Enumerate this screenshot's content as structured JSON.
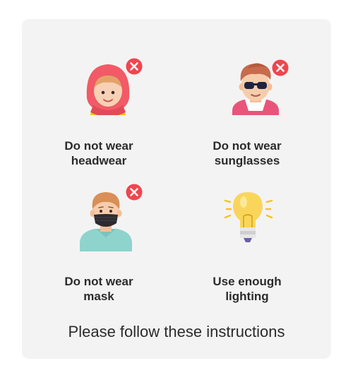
{
  "instructions": [
    {
      "id": "headwear",
      "line1": "Do not wear",
      "line2": "headwear",
      "status": "not-allowed",
      "icon": "person-headscarf-icon"
    },
    {
      "id": "sunglasses",
      "line1": "Do not wear",
      "line2": "sunglasses",
      "status": "not-allowed",
      "icon": "person-sunglasses-icon"
    },
    {
      "id": "mask",
      "line1": "Do not wear",
      "line2": "mask",
      "status": "not-allowed",
      "icon": "person-mask-icon"
    },
    {
      "id": "lighting",
      "line1": "Use enough",
      "line2": "lighting",
      "status": "allowed",
      "icon": "lightbulb-icon"
    }
  ],
  "footer": {
    "text": "Please follow these instructions"
  },
  "colors": {
    "card_background": "#f3f3f3",
    "not_allowed_badge": "#f0454f",
    "text": "#2b2b2b"
  }
}
